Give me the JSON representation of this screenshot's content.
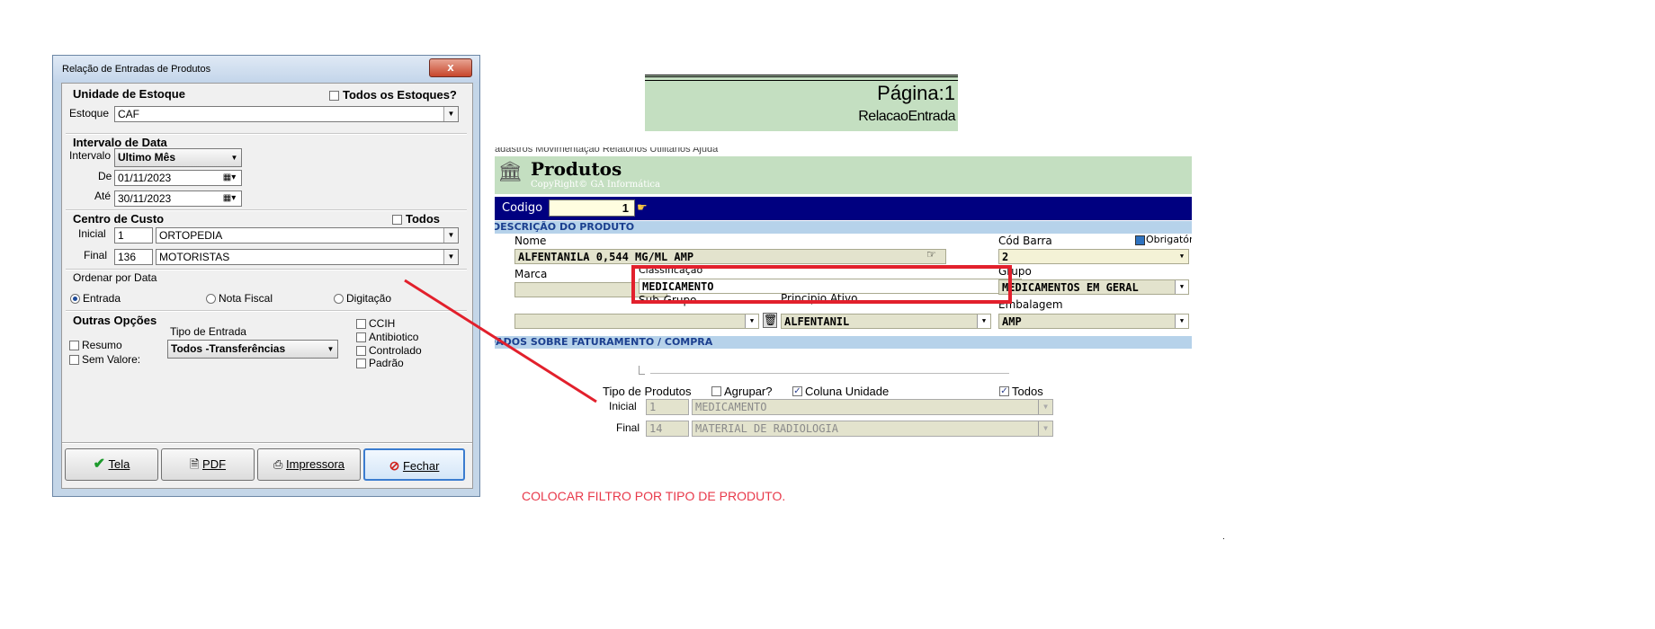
{
  "dialog": {
    "title": "Relação de Entradas de Produtos",
    "close_glyph": "x",
    "unidade": {
      "heading": "Unidade de Estoque",
      "todos_label": "Todos os Estoques?",
      "estoque_label": "Estoque",
      "estoque_value": "CAF"
    },
    "intervalo": {
      "heading": "Intervalo de Data",
      "intervalo_label": "Intervalo",
      "intervalo_value": "Ultimo Mês",
      "de_label": "De",
      "de_value": "01/11/2023",
      "ate_label": "Até",
      "ate_value": "30/11/2023"
    },
    "centro": {
      "heading": "Centro de Custo",
      "todos_label": "Todos",
      "inicial_label": "Inicial",
      "inicial_code": "1",
      "inicial_name": "ORTOPEDIA",
      "final_label": "Final",
      "final_code": "136",
      "final_name": "MOTORISTAS"
    },
    "ordenar": {
      "heading": "Ordenar por Data",
      "options": [
        "Entrada",
        "Nota Fiscal",
        "Digitação"
      ],
      "selected": "Entrada"
    },
    "outras": {
      "heading": "Outras Opções",
      "tipo_entrada_label": "Tipo de Entrada",
      "tipo_entrada_value": "Todos -Transferências",
      "resumo_label": "Resumo",
      "sem_valores_label": "Sem Valore:",
      "checks": [
        "CCIH",
        "Antibiotico",
        "Controlado",
        "Padrão"
      ]
    },
    "buttons": {
      "tela": "Tela",
      "pdf": "PDF",
      "impressora": "Impressora",
      "fechar": "Fechar"
    }
  },
  "report_header": {
    "page_label": "Página:1",
    "report_name": "RelacaoEntrada"
  },
  "produtos": {
    "menu_fragment": "adastros   Movimentação   Relatórios   Utilitários   Ajuda",
    "title": "Produtos",
    "copyright": "CopyRight© GA Informática",
    "codigo_label": "Codigo",
    "codigo_value": "1",
    "section_descricao": "DESCRIÇÃO DO PRODUTO",
    "nome_label": "Nome",
    "nome_value": "ALFENTANILA 0,544 MG/ML AMP",
    "cod_barra_label": "Cód Barra",
    "cod_barra_value": "2",
    "obrigatorio_label": "Obrigatório",
    "marca_label": "Marca",
    "classificacao_label": "Classificação",
    "classificacao_value": "MEDICAMENTO",
    "grupo_label": "Grupo",
    "grupo_value": "MEDICAMENTOS EM GERAL",
    "subgrupo_label": "Sub-Grupo",
    "principio_label": "Principio Ativo",
    "principio_value": "ALFENTANIL",
    "embalagem_label": "Embalagem",
    "embalagem_value": "AMP",
    "section_faturamento": "DADOS SOBRE FATURAMENTO / COMPRA"
  },
  "tipo_produtos": {
    "heading": "Tipo de Produtos",
    "agrupar_label": "Agrupar?",
    "coluna_unidade_label": "Coluna Unidade",
    "todos_label": "Todos",
    "inicial_label": "Inicial",
    "inicial_code": "1",
    "inicial_name": "MEDICAMENTO",
    "final_label": "Final",
    "final_code": "14",
    "final_name": "MATERIAL DE RADIOLOGIA"
  },
  "annotation": {
    "note": "COLOCAR FILTRO POR TIPO DE PRODUTO.",
    "color": "#e8394a"
  },
  "stray_dot": "."
}
